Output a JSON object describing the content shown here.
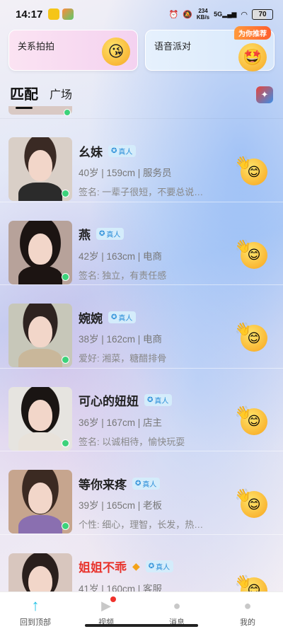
{
  "status_bar": {
    "time": "14:17",
    "net_speed_value": "234",
    "net_speed_unit": "KB/s",
    "network": "5G",
    "battery": "70"
  },
  "cards": {
    "left_label": "关系拍拍",
    "right_label": "语音派对",
    "right_badge": "为你推荐"
  },
  "tabs": {
    "active": "匹配",
    "other": "广场"
  },
  "users": [
    {
      "name": "幺妹",
      "verified": "真人",
      "meta": "40岁 | 159cm | 服务员",
      "bio": "签名: 一辈子很短，不要总说…",
      "name_color": "default"
    },
    {
      "name": "燕",
      "verified": "真人",
      "meta": "42岁 | 163cm | 电商",
      "bio": "签名: 独立，有责任感",
      "name_color": "default"
    },
    {
      "name": "婉婉",
      "verified": "真人",
      "meta": "38岁 | 162cm | 电商",
      "bio": "爱好: 湘菜，糖醋排骨",
      "name_color": "default"
    },
    {
      "name": "可心的妞妞",
      "verified": "真人",
      "meta": "36岁 | 167cm | 店主",
      "bio": "签名: 以诚相待，愉快玩耍",
      "name_color": "default"
    },
    {
      "name": "等你来疼",
      "verified": "真人",
      "meta": "39岁 | 165cm | 老板",
      "bio": "个性: 细心，理智，长发，热…",
      "name_color": "default"
    },
    {
      "name": "姐姐不乖",
      "verified": "真人",
      "meta": "41岁 | 160cm | 客服",
      "bio": "",
      "name_color": "red"
    }
  ],
  "bottom_nav": [
    {
      "label": "回到顶部",
      "icon": "arrow-up-icon"
    },
    {
      "label": "视频",
      "icon": "video-icon"
    },
    {
      "label": "消息",
      "icon": "message-icon"
    },
    {
      "label": "我的",
      "icon": "profile-icon"
    }
  ],
  "colors": {
    "accent": "#21c2e6",
    "online": "#3cd27a",
    "verified_bg": "#d4ecfb",
    "highlight_name": "#e8332c"
  }
}
